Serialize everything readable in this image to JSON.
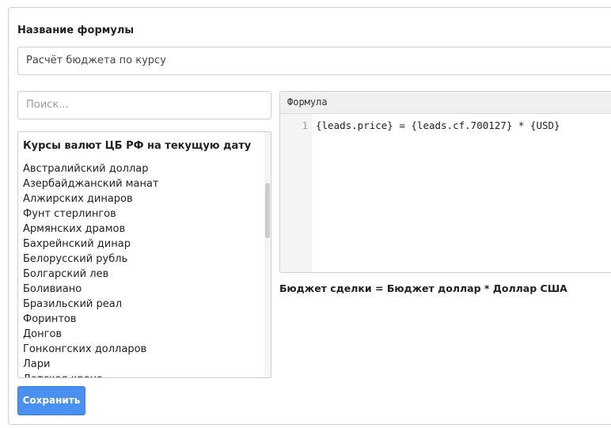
{
  "form": {
    "name_label": "Название формулы",
    "name_value": "Расчёт бюджета по курсу",
    "save_label": "Сохранить"
  },
  "search": {
    "placeholder": "Поиск..."
  },
  "variables": {
    "header": "Курсы валют ЦБ РФ на текущую дату",
    "items": [
      "Австралийский доллар",
      "Азербайджанский манат",
      "Алжирских динаров",
      "Фунт стерлингов",
      "Армянских драмов",
      "Бахрейнский динар",
      "Белорусский рубль",
      "Болгарский лев",
      "Боливиано",
      "Бразильский реал",
      "Форинтов",
      "Донгов",
      "Гонконгских долларов",
      "Лари",
      "Датская крона"
    ]
  },
  "editor": {
    "header": "Формула",
    "line_number": "1",
    "code": "{leads.price} = {leads.cf.700127} * {USD}"
  },
  "preview": {
    "text": "Бюджет сделки = Бюджет доллар * Доллар США"
  }
}
